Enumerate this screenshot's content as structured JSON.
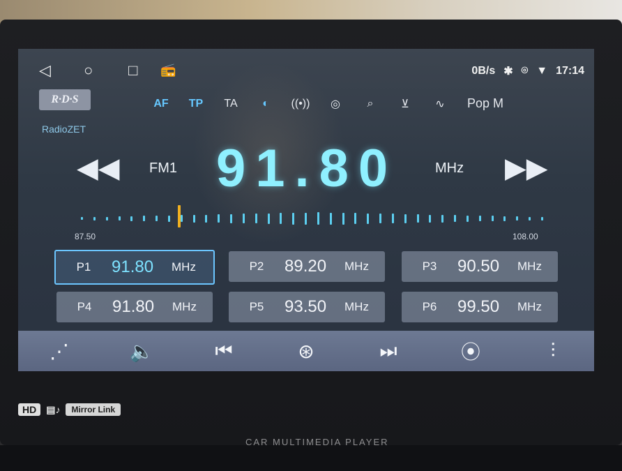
{
  "system_bar": {
    "nav": [
      "◁",
      "○",
      "□",
      "📻"
    ],
    "speed": "0B/s",
    "time": "17:14"
  },
  "rds": {
    "logo": "R·D·S",
    "station": "RadioZET"
  },
  "toolbar": {
    "af": "AF",
    "tp": "TP",
    "ta": "TA",
    "pty": "Pop M"
  },
  "tuner": {
    "band": "FM1",
    "frequency": "91.80",
    "unit": "MHz",
    "scale_min": "87.50",
    "scale_max": "108.00",
    "tuned_fraction": 0.211
  },
  "presets": [
    {
      "label": "P1",
      "freq": "91.80",
      "unit": "MHz",
      "active": true
    },
    {
      "label": "P2",
      "freq": "89.20",
      "unit": "MHz",
      "active": false
    },
    {
      "label": "P3",
      "freq": "90.50",
      "unit": "MHz",
      "active": false
    },
    {
      "label": "P4",
      "freq": "91.80",
      "unit": "MHz",
      "active": false
    },
    {
      "label": "P5",
      "freq": "93.50",
      "unit": "MHz",
      "active": false
    },
    {
      "label": "P6",
      "freq": "99.50",
      "unit": "MHz",
      "active": false
    }
  ],
  "bezel": {
    "hd": "HD",
    "mirror_link": "Mirror Link",
    "player_text": "CAR MULTIMEDIA PLAYER"
  },
  "colors": {
    "accent": "#6cc6ff",
    "frequency": "#8ff0ff",
    "needle": "#f0b020"
  }
}
